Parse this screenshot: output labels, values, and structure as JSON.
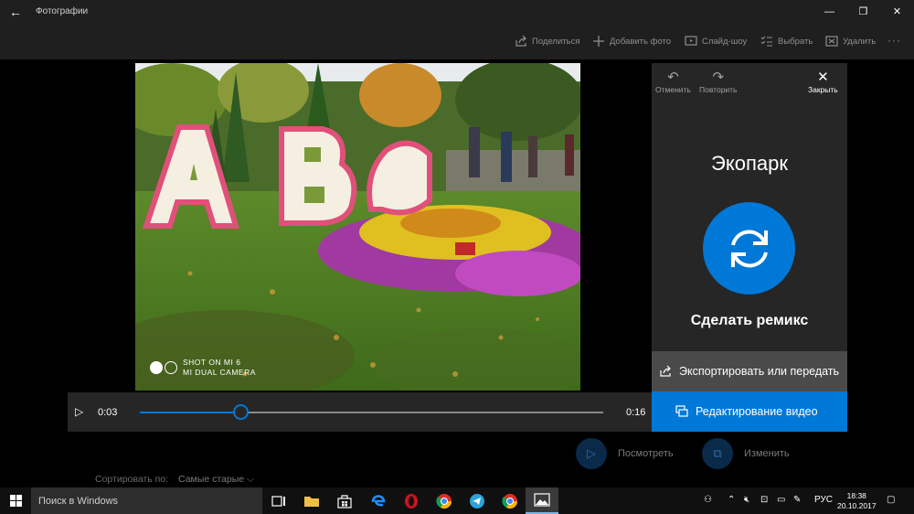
{
  "window": {
    "app_title": "Фотографии",
    "back_glyph": "←",
    "minimize_glyph": "—",
    "maximize_glyph": "❐",
    "close_glyph": "✕"
  },
  "commands": {
    "share": "Поделиться",
    "add_photo": "Добавить фото",
    "slideshow": "Слайд-шоу",
    "select": "Выбрать",
    "delete": "Удалить",
    "more": "···"
  },
  "photo": {
    "watermark_line1": "SHOT ON MI 6",
    "watermark_line2": "MI DUAL CAMERA"
  },
  "panel": {
    "undo_label": "Отменить",
    "redo_label": "Повторить",
    "close_label": "Закрыть",
    "title": "Экопарк",
    "remix_label": "Сделать ремикс",
    "export_label": "Экспортировать или передать",
    "edit_label": "Редактирование видео"
  },
  "player": {
    "current_time": "0:03",
    "end_time": "0:16",
    "progress": 0.217
  },
  "bottom": {
    "watch_label": "Посмотреть",
    "change_label": "Изменить",
    "sort_label": "Сортировать по:",
    "sort_value": "Самые старые"
  },
  "taskbar": {
    "search_placeholder": "Поиск в Windows",
    "lang": "РУС",
    "time": "18:38",
    "date": "20.10.2017"
  },
  "colors": {
    "accent": "#0078d7",
    "panel_bg": "#262626",
    "titlebar_bg": "#1f1f1f"
  }
}
